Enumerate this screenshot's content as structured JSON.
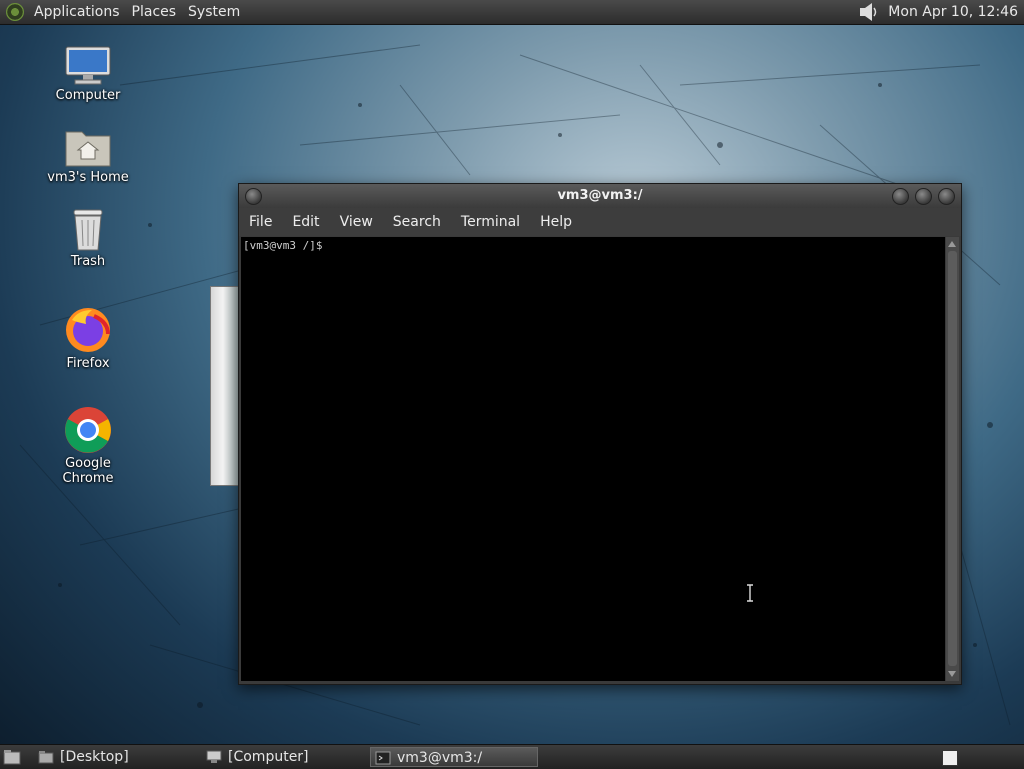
{
  "top_panel": {
    "menus": [
      "Applications",
      "Places",
      "System"
    ],
    "clock": "Mon Apr 10, 12:46"
  },
  "desktop_icons": [
    {
      "label": "Computer",
      "icon": "computer-icon"
    },
    {
      "label": "vm3's Home",
      "icon": "home-folder-icon"
    },
    {
      "label": "Trash",
      "icon": "trash-icon"
    },
    {
      "label": "Firefox",
      "icon": "firefox-icon"
    },
    {
      "label": "Google Chrome",
      "icon": "chrome-icon"
    }
  ],
  "terminal": {
    "title": "vm3@vm3:/",
    "menu": [
      "File",
      "Edit",
      "View",
      "Search",
      "Terminal",
      "Help"
    ],
    "prompt": "[vm3@vm3 /]$"
  },
  "taskbar": {
    "items": [
      "[Desktop]",
      "[Computer]",
      "vm3@vm3:/"
    ]
  }
}
